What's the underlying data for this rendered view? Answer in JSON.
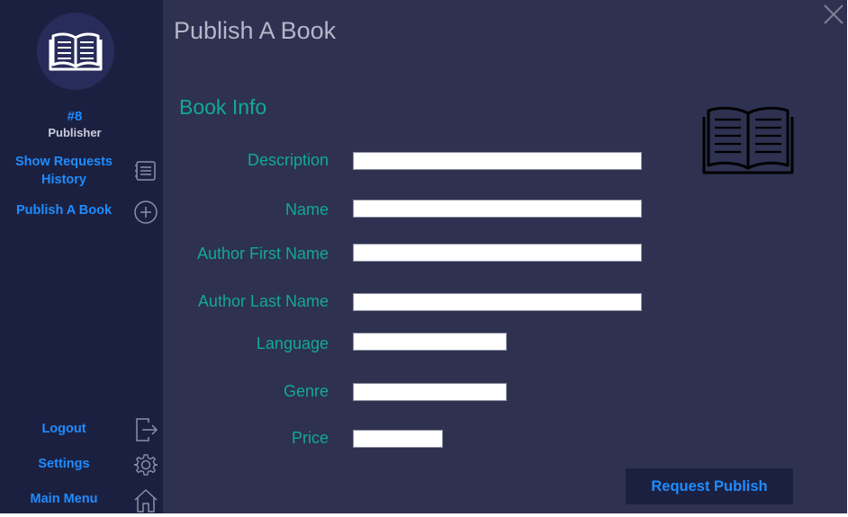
{
  "window": {
    "title": "Publish A Book"
  },
  "icons": {
    "close": "close-icon",
    "book": "open-book-icon"
  },
  "colors": {
    "accent": "#1e8cff",
    "label": "#12a89a",
    "sidebar": "#1c2040",
    "background": "#2e3150"
  },
  "user": {
    "id": "#8",
    "role": "Publisher"
  },
  "sidebar": {
    "nav": [
      {
        "label_line1": "Show Requests",
        "label_line2": "History",
        "icon": "history-list-icon"
      },
      {
        "label": "Publish A Book",
        "icon": "add-circle-icon"
      }
    ],
    "bottom": [
      {
        "label": "Logout",
        "icon": "logout-icon"
      },
      {
        "label": "Settings",
        "icon": "gear-icon"
      },
      {
        "label": "Main Menu",
        "icon": "home-icon"
      }
    ]
  },
  "form": {
    "section_title": "Book Info",
    "fields": [
      {
        "label": "Description",
        "value": ""
      },
      {
        "label": "Name",
        "value": ""
      },
      {
        "label": "Author First Name",
        "value": ""
      },
      {
        "label": "Author Last Name",
        "value": ""
      },
      {
        "label": "Language",
        "value": ""
      },
      {
        "label": "Genre",
        "value": ""
      },
      {
        "label": "Price",
        "value": ""
      }
    ],
    "submit_label": "Request Publish"
  }
}
